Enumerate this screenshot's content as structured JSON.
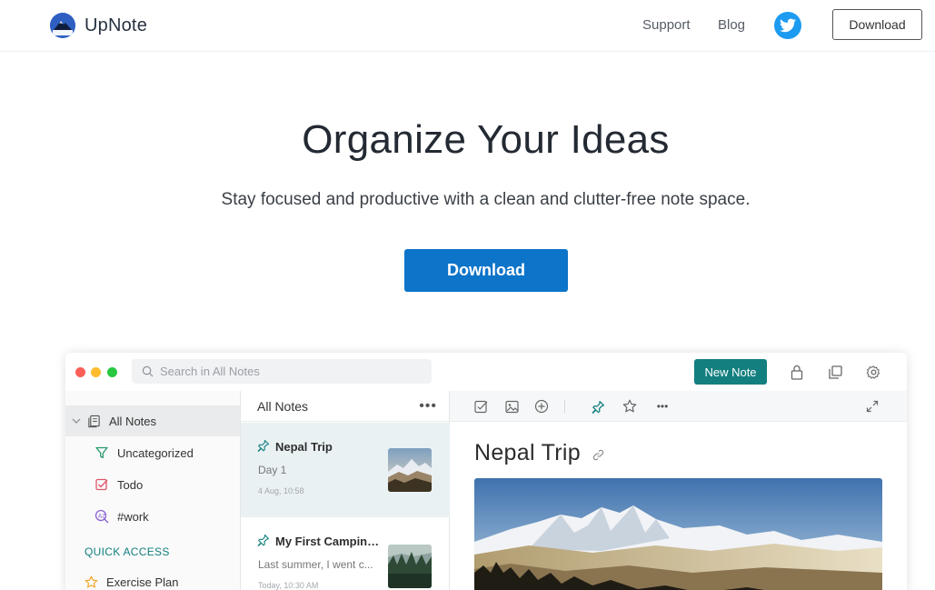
{
  "nav": {
    "brand": "UpNote",
    "links": [
      "Support",
      "Blog"
    ],
    "download_label": "Download"
  },
  "hero": {
    "title": "Organize Your Ideas",
    "subtitle": "Stay focused and productive with a clean and clutter-free note space.",
    "cta_label": "Download"
  },
  "app": {
    "search_placeholder": "Search in All Notes",
    "new_note_label": "New Note",
    "sidebar": {
      "items": [
        {
          "label": "All Notes",
          "icon": "notes-icon",
          "active": true
        },
        {
          "label": "Uncategorized",
          "icon": "filter-icon"
        },
        {
          "label": "Todo",
          "icon": "checkbox-icon"
        },
        {
          "label": "#work",
          "icon": "tag-search-icon"
        }
      ],
      "quick_access_title": "QUICK ACCESS",
      "quick_items": [
        {
          "label": "Exercise Plan",
          "icon": "star-icon"
        }
      ]
    },
    "list": {
      "title": "All Notes",
      "more": "•••",
      "notes": [
        {
          "title": "Nepal Trip",
          "snippet": "Day 1",
          "date": "4 Aug, 10:58",
          "pinned": true,
          "active": true
        },
        {
          "title": "My First Camping...",
          "snippet": "Last summer, I went c...",
          "date": "Today, 10:30 AM",
          "pinned": true,
          "active": false
        }
      ]
    },
    "editor": {
      "title": "Nepal Trip",
      "more": "•••"
    }
  },
  "colors": {
    "accent": "#0c74c9",
    "teal": "#137f7f",
    "twitter": "#1d9bf0"
  }
}
